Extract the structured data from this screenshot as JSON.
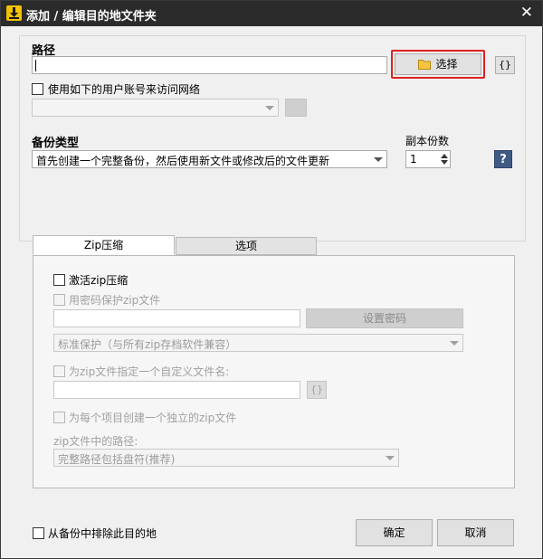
{
  "window": {
    "title": "添加 / 编辑目的地文件夹",
    "close_glyph": "✕"
  },
  "path_section": {
    "label": "路径",
    "path_value": "",
    "choose_button": "选择",
    "braces_button": "{}",
    "use_account_checkbox": "使用如下的用户账号来访问网络",
    "account_value": ""
  },
  "backup_type": {
    "label": "备份类型",
    "selected": "首先创建一个完整备份，然后使用新文件或修改后的文件更新",
    "copies_label": "副本份数",
    "copies_value": "1",
    "help_glyph": "?"
  },
  "tabs": [
    {
      "label": "Zip压缩"
    },
    {
      "label": "选项"
    }
  ],
  "zip": {
    "activate": "激活zip压缩",
    "password_protect": "用密码保护zip文件",
    "password_value": "",
    "set_password_button": "设置密码",
    "protection_selected": "标准保护（与所有zip存档软件兼容）",
    "custom_name": "为zip文件指定一个自定义文件名:",
    "custom_name_value": "",
    "custom_braces": "{}",
    "per_item": "为每个项目创建一个独立的zip文件",
    "path_in_zip_label": "zip文件中的路径:",
    "path_in_zip_selected": "完整路径包括盘符(推荐)"
  },
  "footer": {
    "exclude_checkbox": "从备份中排除此目的地",
    "ok_button": "确定",
    "cancel_button": "取消"
  },
  "colors": {
    "titlebar": "#2b2b2b",
    "app_icon": "#f2c200",
    "highlight_border": "#e02020",
    "help_icon": "#3f5a85"
  }
}
